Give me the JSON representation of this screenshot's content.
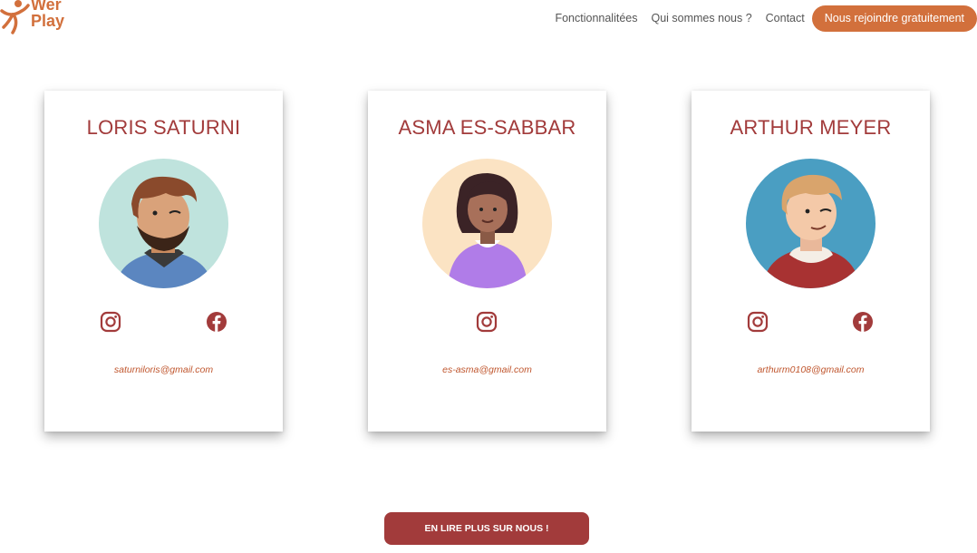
{
  "header": {
    "logo_line1": "Wer",
    "logo_line2": "Play",
    "nav": {
      "features": "Fonctionnalitées",
      "about": "Qui sommes nous ?",
      "contact": "Contact",
      "join": "Nous rejoindre gratuitement"
    }
  },
  "cards": [
    {
      "name": "LORIS SATURNI",
      "email": "saturniloris@gmail.com",
      "icons": [
        "instagram-icon",
        "facebook-icon"
      ]
    },
    {
      "name": "ASMA ES-SABBAR",
      "email": "es-asma@gmail.com",
      "icons": [
        "instagram-icon"
      ]
    },
    {
      "name": "ARTHUR MEYER",
      "email": "arthurm0108@gmail.com",
      "icons": [
        "instagram-icon",
        "facebook-icon"
      ]
    }
  ],
  "read_more": "EN LIRE PLUS SUR NOUS !",
  "colors": {
    "brand_orange": "#d2703c",
    "title_red": "#a23b3b",
    "email_orange": "#c0572f"
  }
}
